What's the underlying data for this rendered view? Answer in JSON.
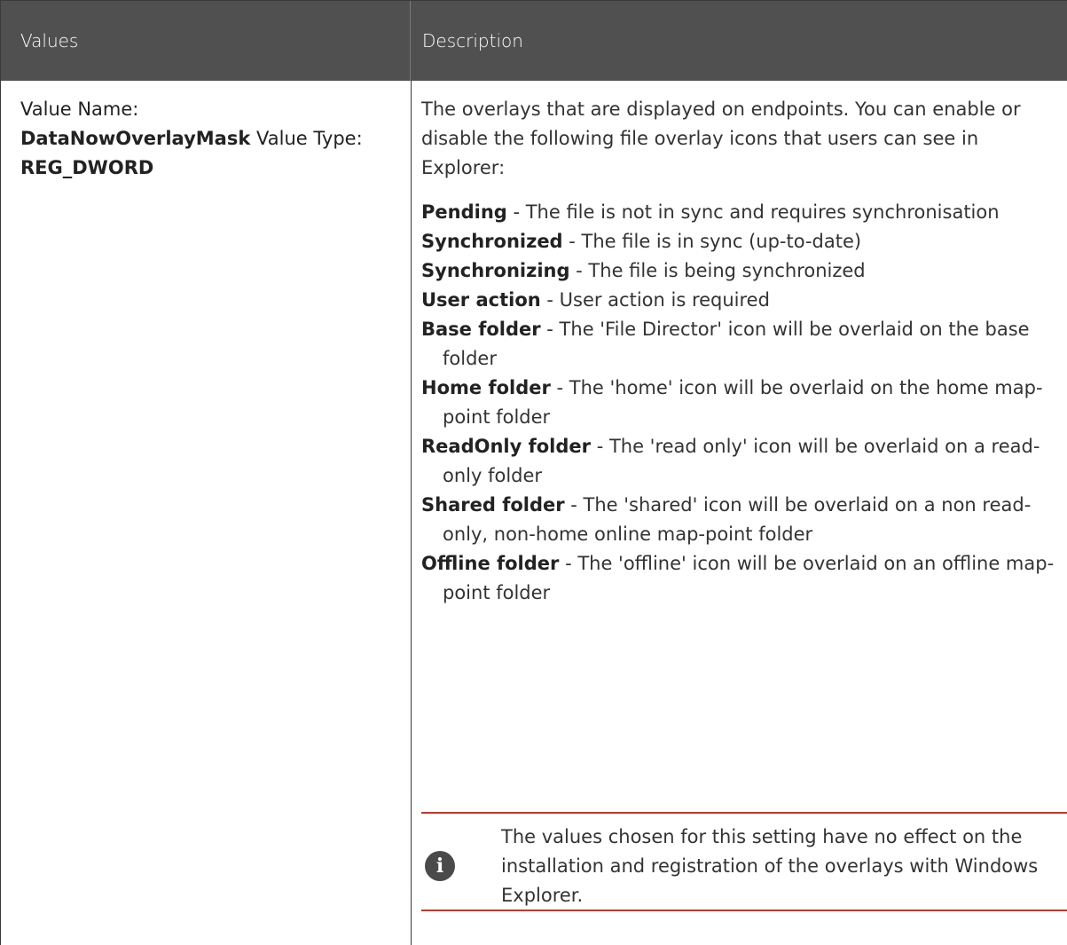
{
  "header": {
    "col_values": "Values",
    "col_description": "Description"
  },
  "values_cell": {
    "label1": "Value Name:",
    "value_name": "DataNowOverlayMask",
    "label2": "Value Type:",
    "value_type": "REG_DWORD"
  },
  "description": {
    "intro": "The overlays that are displayed on endpoints. You can enable or disable the following file overlay icons that users can see in Explorer:",
    "items": [
      {
        "term": "Pending",
        "text": " - The file is not in sync and requires synchronisation"
      },
      {
        "term": "Synchronized",
        "text": " - The file is in sync (up-to-date)"
      },
      {
        "term": "Synchronizing",
        "text": " - The file is being synchronized"
      },
      {
        "term": "User action",
        "text": " - User action is required"
      },
      {
        "term": "Base folder",
        "text": " - The 'File Director' icon will be overlaid on the base folder"
      },
      {
        "term": "Home folder",
        "text": " - The 'home' icon will be overlaid on the home map-point folder"
      },
      {
        "term": "ReadOnly folder",
        "text": " - The 'read only' icon will be overlaid on a read-only folder"
      },
      {
        "term": "Shared folder",
        "text": " - The 'shared' icon will be overlaid on a non read-only, non-home online map-point folder"
      },
      {
        "term": "Offline folder",
        "text": " - The 'offline' icon will be overlaid on an offline map-point folder"
      }
    ],
    "note": "The values chosen for this setting have no effect on the installation and registration of the overlays with Windows Explorer.",
    "note_icon": "info-icon"
  },
  "colors": {
    "header_bg": "#505050",
    "note_rule": "#c0392b"
  }
}
